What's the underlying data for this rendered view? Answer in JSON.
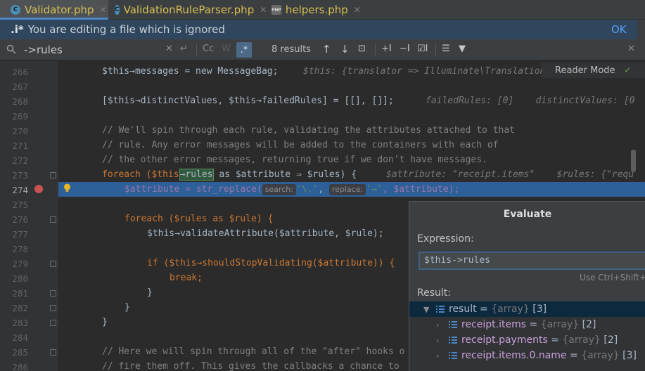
{
  "tabs": [
    {
      "label": "Validator.php",
      "icon": "C",
      "active": true
    },
    {
      "label": "ValidationRuleParser.php",
      "icon": "C",
      "active": false
    },
    {
      "label": "helpers.php",
      "icon": "PHP",
      "active": false
    }
  ],
  "notice": {
    "pattern": ".i*",
    "message": "You are editing a file which is ignored",
    "ok": "OK"
  },
  "search": {
    "query": "->rules",
    "case_label": "Cc",
    "word_label": "W",
    "regex_label": ".*",
    "results": "8 results"
  },
  "reader_mode": "Reader Mode",
  "lines": [
    {
      "n": "266",
      "code": "$this→messages = new MessageBag;",
      "hint": "$this: {translator => Illuminate\\Translation"
    },
    {
      "n": "267"
    },
    {
      "n": "268",
      "code": "[$this→distinctValues, $this→failedRules] = [[], []];",
      "hint": "failedRules: [0]    distinctValues: [0"
    },
    {
      "n": "269"
    },
    {
      "n": "270",
      "code": "// We'll spin through each rule, validating the attributes attached to that"
    },
    {
      "n": "271",
      "code": "// rule. Any error messages will be added to the containers with each of"
    },
    {
      "n": "272",
      "code": "// the other error messages, returning true if we don't have messages."
    },
    {
      "n": "273",
      "code_a": "foreach ($this",
      "code_match": "→rules",
      "code_b": " as $attribute ⇒ $rules) {",
      "hint": "$attribute: \"receipt.items\"    $rules: {\"requ"
    },
    {
      "n": "274",
      "code_a": "$attribute = str_replace(",
      "p1": "search:",
      "s1": "'\\.'",
      "p2": "replace:",
      "s2": "'→'",
      "code_b": ", $attribute);"
    },
    {
      "n": "275"
    },
    {
      "n": "276",
      "code": "foreach ($rules as $rule) {"
    },
    {
      "n": "277",
      "code": "$this→validateAttribute($attribute, $rule);"
    },
    {
      "n": "278"
    },
    {
      "n": "279",
      "code": "if ($this→shouldStopValidating($attribute)) {"
    },
    {
      "n": "280",
      "code": "break;"
    },
    {
      "n": "281",
      "code": "}"
    },
    {
      "n": "282",
      "code": "}"
    },
    {
      "n": "283",
      "code": "}"
    },
    {
      "n": "284"
    },
    {
      "n": "285",
      "code": "// Here we will spin through all of the \"after\" hooks o"
    },
    {
      "n": "286",
      "code": "// fire them off. This gives the callbacks a chance to"
    }
  ],
  "evaluate": {
    "title": "Evaluate",
    "expression_label": "Expression:",
    "expression": "$this->rules",
    "hint": "Use Ctrl+Shift+E",
    "result_label": "Result:",
    "rows": [
      {
        "name": "result",
        "type": "{array}",
        "count": "[3]"
      },
      {
        "name": "receipt.items",
        "type": "{array}",
        "count": "[2]"
      },
      {
        "name": "receipt.payments",
        "type": "{array}",
        "count": "[2]"
      },
      {
        "name": "receipt.items.0.name",
        "type": "{array}",
        "count": "[3]"
      }
    ]
  },
  "colors": {
    "accent": "#4a88c7",
    "selection": "#2d6099",
    "keyword": "#cc7832",
    "variable": "#9876aa",
    "function": "#ffc66d",
    "string": "#6a8759"
  }
}
